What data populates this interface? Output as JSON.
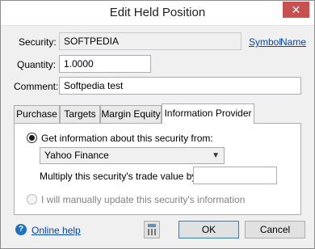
{
  "window": {
    "title": "Edit Held Position",
    "close_glyph": "✕"
  },
  "form": {
    "security_label": "Security:",
    "security_value": "SOFTPEDIA",
    "symbol_link": "Symbol",
    "name_link": "Name",
    "quantity_label": "Quantity:",
    "quantity_value": "1.0000",
    "comment_label": "Comment:",
    "comment_value": "Softpedia test"
  },
  "tabs": [
    {
      "label": "Purchase",
      "active": false
    },
    {
      "label": "Targets",
      "active": false
    },
    {
      "label": "Margin Equity",
      "active": false
    },
    {
      "label": "Information Provider",
      "active": true
    }
  ],
  "provider": {
    "get_info_label": "Get information about this security from:",
    "get_info_checked": true,
    "source_selected": "Yahoo Finance",
    "multiply_label": "Multiply this security's trade value by:",
    "multiply_value": "",
    "manual_label": "I will manually update this security's information",
    "manual_enabled": false
  },
  "footer": {
    "help_icon_glyph": "?",
    "help_link": "Online help",
    "ok_label": "OK",
    "cancel_label": "Cancel"
  }
}
